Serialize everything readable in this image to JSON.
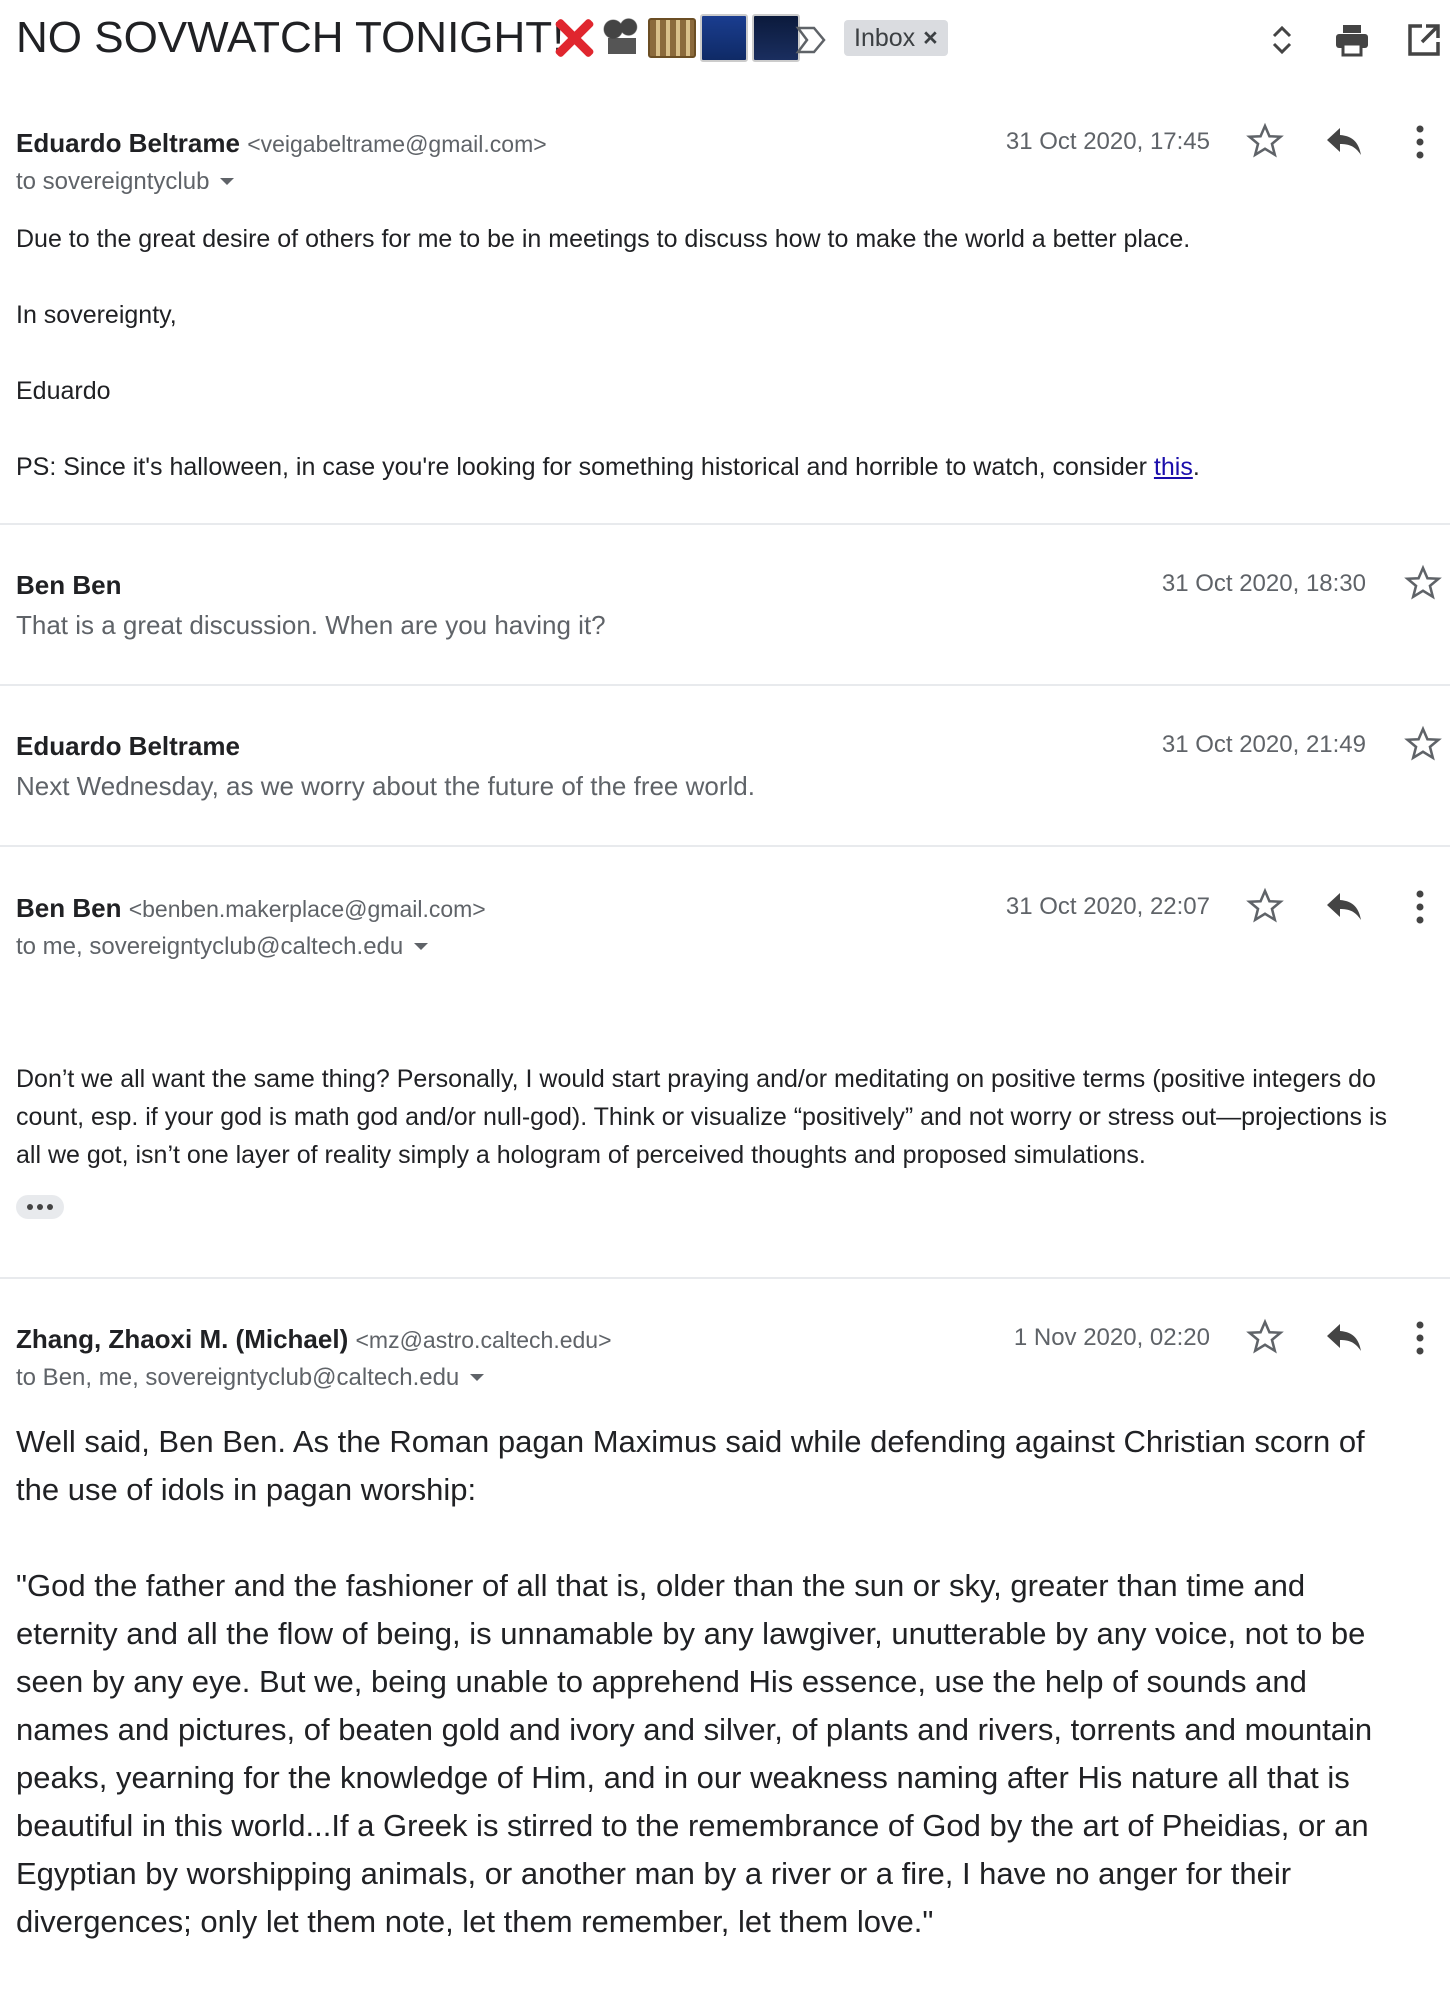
{
  "thread": {
    "subject": "NO SOVWATCH TONIGHT!",
    "emoji_icons": [
      "cross-mark-icon",
      "movie-camera-icon",
      "film-frames-icon",
      "cityscape-night-icon",
      "night-sky-icon"
    ],
    "label_chip": "Inbox",
    "label_remove": "×"
  },
  "messages": [
    {
      "sender": "Eduardo Beltrame",
      "email": "<veigabeltrame@gmail.com>",
      "to": "to sovereigntyclub",
      "date": "31 Oct 2020, 17:45",
      "body": [
        "Due to the great desire of others for me to be in meetings to discuss how to make the world a better place.",
        "In sovereignty,",
        "Eduardo"
      ],
      "ps_prefix": "PS: Since it's halloween, in case you're looking for something historical and horrible to watch, consider ",
      "ps_link": "this",
      "ps_suffix": "."
    },
    {
      "sender": "Ben Ben",
      "date": "31 Oct 2020, 18:30",
      "snippet": "That is a great discussion. When are you having it?"
    },
    {
      "sender": "Eduardo Beltrame",
      "date": "31 Oct 2020, 21:49",
      "snippet": "Next Wednesday, as we worry about the future of the free world."
    },
    {
      "sender": "Ben Ben",
      "email": "<benben.makerplace@gmail.com>",
      "to": "to me, sovereigntyclub@caltech.edu",
      "date": "31 Oct 2020, 22:07",
      "body_lines": [
        "Don’t we all want the same thing?  Personally, I would start praying and/or meditating on positive terms (positive integers do",
        "count, esp. if your god is math god and/or null-god).  Think or visualize “positively” and not worry or stress out—projections is",
        "all we got, isn’t one layer of reality simply a hologram of perceived thoughts and proposed simulations."
      ]
    },
    {
      "sender": "Zhang, Zhaoxi M. (Michael)",
      "email": "<mz@astro.caltech.edu>",
      "to": "to Ben, me, sovereigntyclub@caltech.edu",
      "date": "1 Nov 2020, 02:20",
      "para1": [
        "Well said, Ben Ben.  As the Roman pagan Maximus said while defending against Christian scorn of",
        "the use of idols in pagan worship:"
      ],
      "para2": [
        "\"God the father and the fashioner of all that is, older than the sun or sky, greater than time and",
        "eternity and all the flow of being, is unnamable by any lawgiver, unutterable by any voice, not to be",
        "seen by any eye.  But we, being unable to apprehend His essence, use the help of sounds and",
        "names and pictures, of beaten gold and ivory and silver, of plants and rivers, torrents and mountain",
        "peaks, yearning for the knowledge of Him, and in our weakness naming after His nature all that is",
        "beautiful in this world...If a Greek is stirred to the remembrance of God by the art of Pheidias, or an",
        "Egyptian by worshipping animals, or another man by a river or a fire, I have no anger for their",
        "divergences; only let them note, let them remember, let them love.\""
      ]
    }
  ],
  "colors": {
    "text": "#202124",
    "secondary": "#5f6368",
    "link": "#1a0dab",
    "chip_bg": "#dadce0",
    "divider": "#e8eaed"
  }
}
